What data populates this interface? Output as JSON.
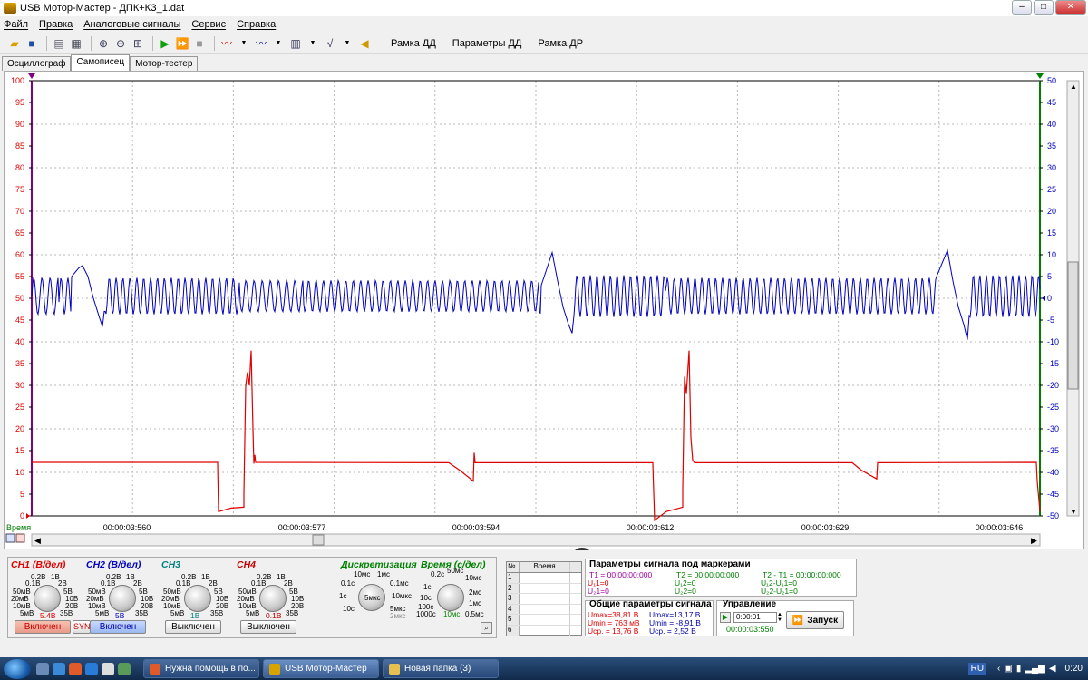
{
  "window": {
    "title": "USB Мотор-Мастер - ДПК+КЗ_1.dat",
    "min": "–",
    "max": "□",
    "close": "✕"
  },
  "menu": [
    "Файл",
    "Правка",
    "Аналоговые сигналы",
    "Сервис",
    "Справка"
  ],
  "toolbar": {
    "frame_dd": "Рамка ДД",
    "params_dd": "Параметры ДД",
    "frame_dr": "Рамка ДР"
  },
  "tabs": [
    "Осциллограф",
    "Самописец",
    "Мотор-тестер"
  ],
  "tabs_active": 1,
  "plot": {
    "left_axis": [
      "100",
      "95",
      "90",
      "85",
      "80",
      "75",
      "70",
      "65",
      "60",
      "55",
      "50",
      "45",
      "40",
      "35",
      "30",
      "25",
      "20",
      "15",
      "10",
      "5",
      "0"
    ],
    "right_axis": [
      "50",
      "45",
      "40",
      "35",
      "30",
      "25",
      "20",
      "15",
      "10",
      "5",
      "0",
      "-5",
      "-10",
      "-15",
      "-20",
      "-25",
      "-30",
      "-35",
      "-40",
      "-45",
      "-50"
    ],
    "time_label": "Время",
    "time_ticks": [
      "00:00:03:560",
      "00:00:03:577",
      "00:00:03:594",
      "00:00:03:612",
      "00:00:03:629",
      "00:00:03:646"
    ],
    "left_color": "#e00000",
    "right_color": "#0000c0"
  },
  "channels": [
    {
      "title": "CH1 (В/дел)",
      "color": "#e00000",
      "labels": [
        "0.2В",
        "1В",
        "0.1В",
        "2В",
        "50мВ",
        "5В",
        "20мВ",
        "10В",
        "10мВ",
        "20В",
        "5мВ",
        "35В"
      ],
      "value": "5.4В",
      "button": "Включен",
      "extra": "SYN"
    },
    {
      "title": "CH2 (В/дел)",
      "color": "#0000c0",
      "labels": [
        "0.2В",
        "1В",
        "0.1В",
        "2В",
        "50мВ",
        "5В",
        "20мВ",
        "10В",
        "10мВ",
        "20В",
        "5мВ",
        "35В"
      ],
      "value": "5В",
      "button": "Включен"
    },
    {
      "title": "CH3",
      "color": "#008080",
      "labels": [
        "0.2В",
        "1В",
        "0.1В",
        "2В",
        "50мВ",
        "5В",
        "20мВ",
        "10В",
        "10мВ",
        "20В",
        "5мВ",
        "35В"
      ],
      "value": "1В",
      "button": "Выключен"
    },
    {
      "title": "CH4",
      "color": "#c00000",
      "labels": [
        "0.2В",
        "1В",
        "0.1В",
        "2В",
        "50мВ",
        "5В",
        "20мВ",
        "10В",
        "10мВ",
        "20В",
        "5мВ",
        "35В"
      ],
      "value": "0.1В",
      "button": "Выключен"
    }
  ],
  "discret": {
    "title": "Дискретизация",
    "labels": [
      "10мс",
      "1мс",
      "0.1с",
      "0.1мс",
      "1с",
      "10мкс",
      "10с",
      "5мкс",
      "2мкс"
    ],
    "value": "5мкс"
  },
  "timediv": {
    "title": "Время (с/дел)",
    "labels": [
      "0.2с",
      "50мс",
      "10мс",
      "1с",
      "2мс",
      "10с",
      "100с",
      "1мс",
      "1000с",
      "0.5мс"
    ],
    "value": "10мс"
  },
  "marker_table": {
    "col1": "№",
    "col2": "Время",
    "rows": [
      "1",
      "2",
      "3",
      "4",
      "5",
      "6"
    ]
  },
  "markers": {
    "title": "Параметры сигнала под маркерами",
    "t1": "T1 = 00:00:00:000",
    "t2": "T2 = 00:00:00:000",
    "dt": "T2 - T1 = 00:00:00:000",
    "u11": "U₁1=0",
    "u21": "U₂1=0",
    "u12": "U₁2=0",
    "u22": "U₂2=0",
    "du1": "U₁2-U₁1=0",
    "du2": "U₂2-U₂1=0"
  },
  "general": {
    "title": "Общие параметры сигнала",
    "c1": [
      "Umax=38,81 В",
      "Umin = 763 мВ",
      "Ucp. = 13,76 В"
    ],
    "c2": [
      "Umax=13,17 В",
      "Umin = -8,91 В",
      "Ucp. = 2,52 В"
    ]
  },
  "control": {
    "title": "Управление",
    "interval": "0:00:01",
    "elapsed": "00:00:03:550",
    "start": "Запуск"
  },
  "taskbar": {
    "tasks": [
      "Нужна помощь в по...",
      "USB Мотор-Мастер",
      "Новая папка (3)"
    ],
    "lang": "RU",
    "clock": "0:20"
  }
}
